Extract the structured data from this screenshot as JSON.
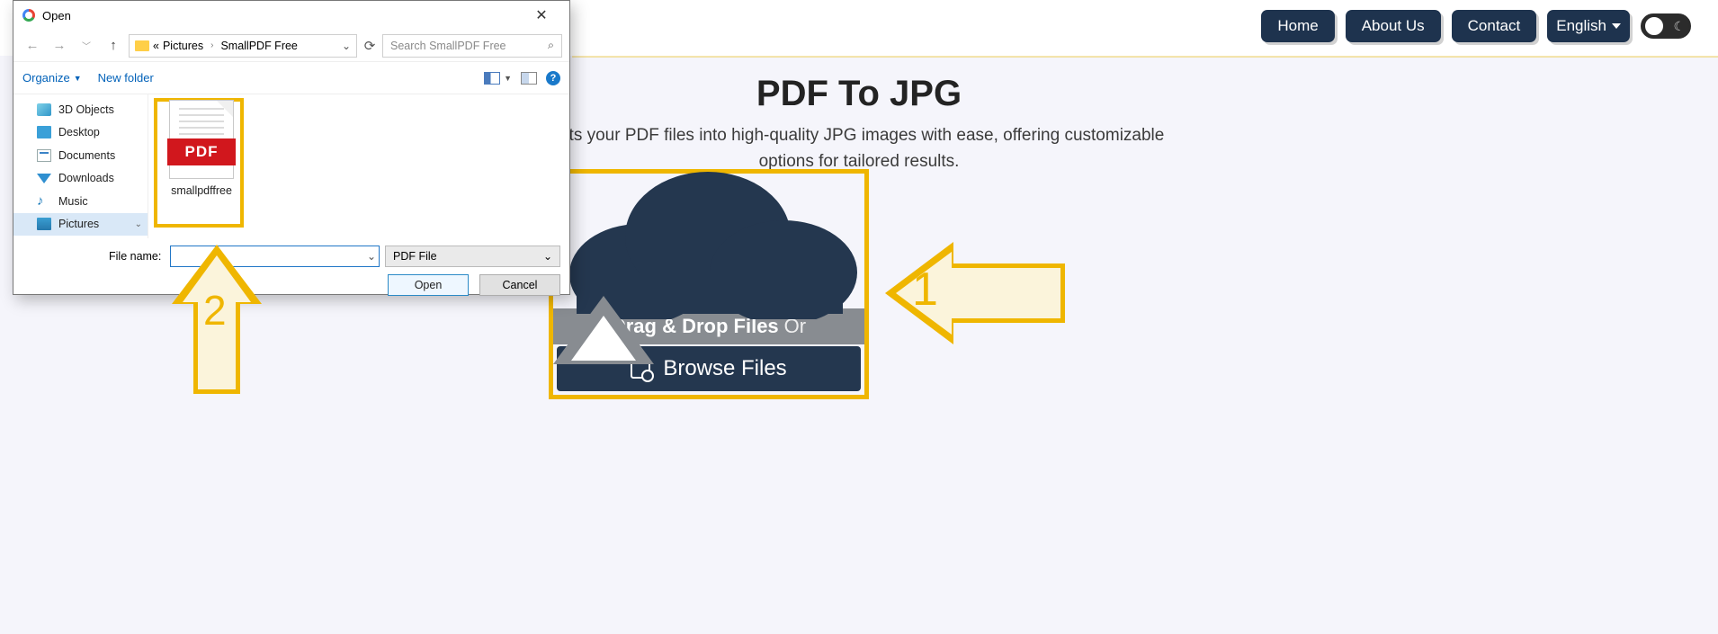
{
  "nav": {
    "home": "Home",
    "about": "About Us",
    "contact": "Contact",
    "language": "English"
  },
  "page": {
    "title": "PDF To JPG",
    "subtitle_prefix": "erts your PDF files into high-quality JPG images with ease, offering customizable",
    "subtitle_line2": "options for tailored results.",
    "drag_label": "Drag & Drop Files",
    "drag_or": "Or",
    "browse_label": "Browse Files"
  },
  "arrows": {
    "one": "1",
    "two": "2"
  },
  "dialog": {
    "title": "Open",
    "path": {
      "ellipsis": "«",
      "seg1": "Pictures",
      "seg2": "SmallPDF Free"
    },
    "search_placeholder": "Search SmallPDF Free",
    "organize": "Organize",
    "new_folder": "New folder",
    "tree": {
      "i0": "3D Objects",
      "i1": "Desktop",
      "i2": "Documents",
      "i3": "Downloads",
      "i4": "Music",
      "i5": "Pictures"
    },
    "file": {
      "name": "smallpdffree",
      "badge": "PDF"
    },
    "file_name_label": "File name:",
    "file_name_value": "",
    "file_type": "PDF File",
    "open_btn": "Open",
    "cancel_btn": "Cancel"
  }
}
